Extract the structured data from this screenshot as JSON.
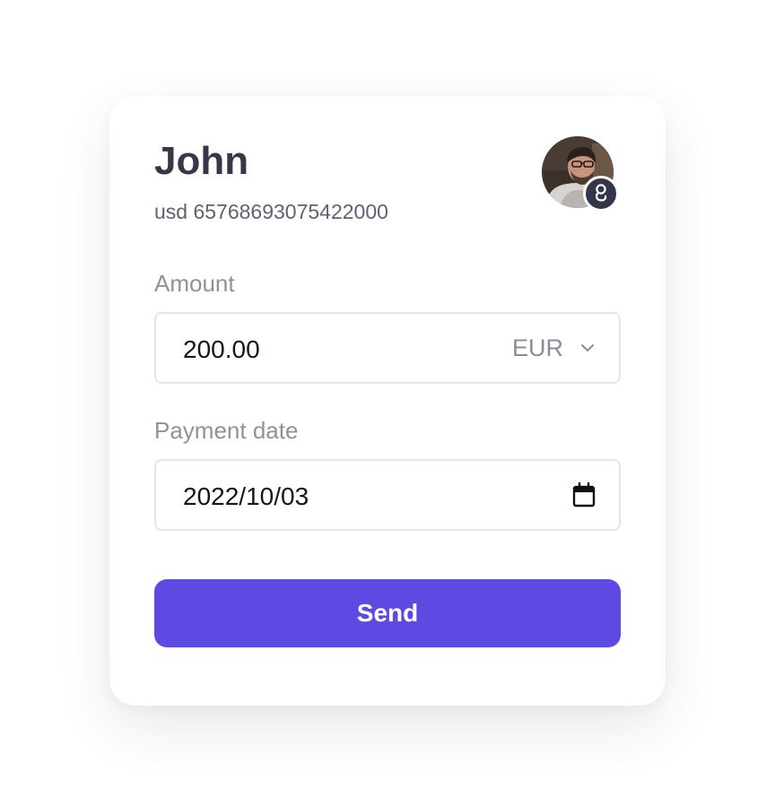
{
  "recipient": {
    "name": "John",
    "account": "usd 65768693075422000",
    "badge_icon": "gtbank-logo-icon"
  },
  "amount": {
    "label": "Amount",
    "value": "200.00",
    "currency": "EUR",
    "currency_icon": "chevron-down-icon"
  },
  "payment_date": {
    "label": "Payment date",
    "value": "2022/10/03",
    "icon": "calendar-icon"
  },
  "send_button": {
    "label": "Send"
  },
  "colors": {
    "accent": "#5d4ae2",
    "heading": "#353849",
    "muted": "#8f919c",
    "badge": "#34354a"
  }
}
